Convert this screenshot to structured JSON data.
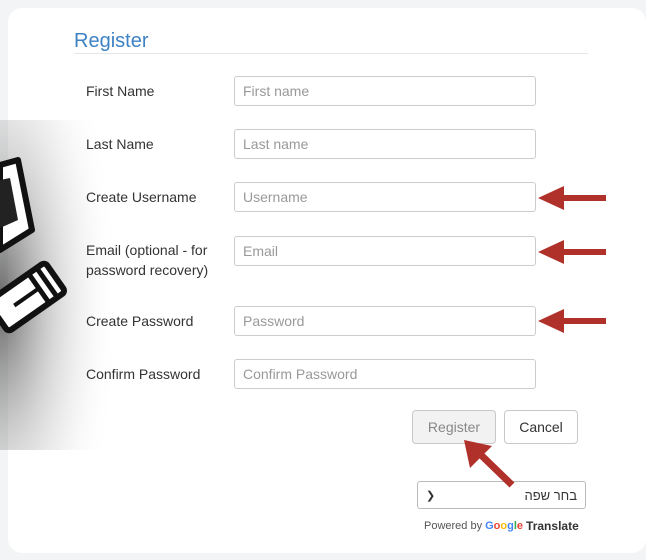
{
  "form": {
    "title": "Register",
    "fields": [
      {
        "label": "First Name",
        "placeholder": "First name"
      },
      {
        "label": "Last Name",
        "placeholder": "Last name"
      },
      {
        "label": "Create Username",
        "placeholder": "Username"
      },
      {
        "label_line1": "Email (optional - for",
        "label_line2": "password recovery)",
        "placeholder": "Email"
      },
      {
        "label": "Create Password",
        "placeholder": "Password"
      },
      {
        "label": "Confirm Password",
        "placeholder": "Confirm Password"
      }
    ],
    "register_label": "Register",
    "cancel_label": "Cancel"
  },
  "translate": {
    "select_value": "בחר שפה",
    "powered_by": "Powered by",
    "google": [
      "G",
      "o",
      "o",
      "g",
      "l",
      "e"
    ],
    "translate_word": "Translate"
  },
  "colors": {
    "title": "#3f82c4",
    "annotation_arrow": "#b0302a",
    "google_letters": [
      "#4285f4",
      "#ea4335",
      "#fbbc05",
      "#4285f4",
      "#34a853",
      "#ea4335"
    ]
  },
  "icons": {
    "decoration": "pencil-icon",
    "select_caret": "chevron-down-icon",
    "annotation": "arrow-icon"
  }
}
